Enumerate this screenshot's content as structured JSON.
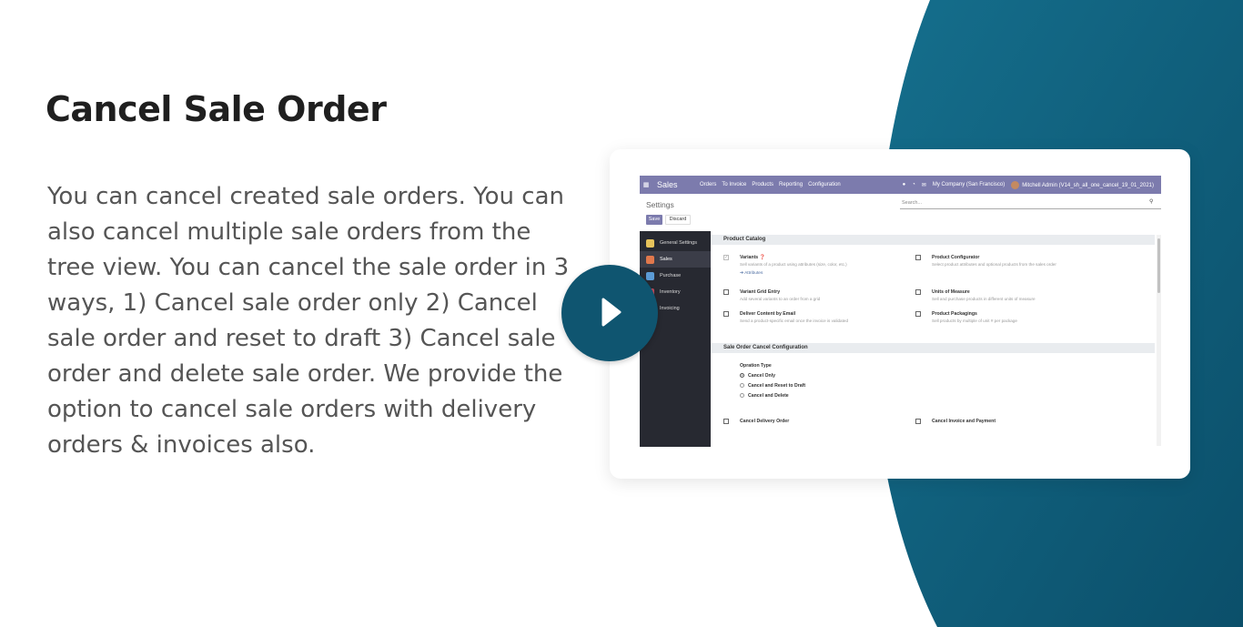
{
  "hero": {
    "title": "Cancel Sale Order",
    "description": "You can cancel created sale orders. You can also cancel multiple sale orders from the tree view. You can cancel the sale order in 3 ways, 1) Cancel sale order only 2) Cancel sale order and reset to draft 3) Cancel sale order and delete sale order. We provide the option to cancel sale orders with delivery orders & invoices also."
  },
  "colors": {
    "accent_teal": "#0f5570",
    "odoo_purple": "#7c7bad",
    "sidebar_dark": "#272931"
  },
  "play_button": {
    "icon": "play-icon"
  },
  "app": {
    "apps_icon": "grid-icon",
    "brand": "Sales",
    "menu": [
      "Orders",
      "To Invoice",
      "Products",
      "Reporting",
      "Configuration"
    ],
    "company": "My Company (San Francisco)",
    "user": "Mitchell Admin (V14_sh_all_one_cancel_19_01_2021)",
    "page_title": "Settings",
    "search_placeholder": "Search...",
    "save_label": "Save",
    "discard_label": "Discard"
  },
  "sidebar": {
    "items": [
      {
        "label": "General Settings",
        "icon_color": "#e6c35b",
        "active": false
      },
      {
        "label": "Sales",
        "icon_color": "#e0784c",
        "active": true
      },
      {
        "label": "Purchase",
        "icon_color": "#5b9bd5",
        "active": false
      },
      {
        "label": "Inventory",
        "icon_color": "#c04a5a",
        "active": false
      },
      {
        "label": "Invoicing",
        "icon_color": "#5aa79a",
        "active": false
      }
    ]
  },
  "settings": {
    "product_catalog": {
      "header": "Product Catalog",
      "variants": {
        "label": "Variants",
        "hint": "Sell variants of a product using attributes (size, color, etc.)",
        "link": "➔ Attributes",
        "checked": true
      },
      "product_configurator": {
        "label": "Product Configurator",
        "hint": "Select product attributes and optional products from the sales order",
        "checked": false
      },
      "variant_grid": {
        "label": "Variant Grid Entry",
        "hint": "Add several variants to an order from a grid",
        "checked": false
      },
      "units_of_measure": {
        "label": "Units of Measure",
        "hint": "Sell and purchase products in different units of measure",
        "checked": false
      },
      "deliver_email": {
        "label": "Deliver Content by Email",
        "hint": "Send a product-specific email once the invoice is validated",
        "checked": false
      },
      "product_packagings": {
        "label": "Product Packagings",
        "hint": "Sell products by multiple of unit # per package",
        "checked": false
      }
    },
    "cancel_config": {
      "header": "Sale Order Cancel Configuration",
      "operation_type_label": "Opration Type",
      "options": [
        "Cancel Only",
        "Cancel and Reset to Draft",
        "Cancel and Delete"
      ],
      "selected": 0,
      "cancel_delivery": {
        "label": "Cancel Delivery Order",
        "checked": false
      },
      "cancel_invoice": {
        "label": "Cancel Invoice and Payment",
        "checked": false
      }
    }
  }
}
